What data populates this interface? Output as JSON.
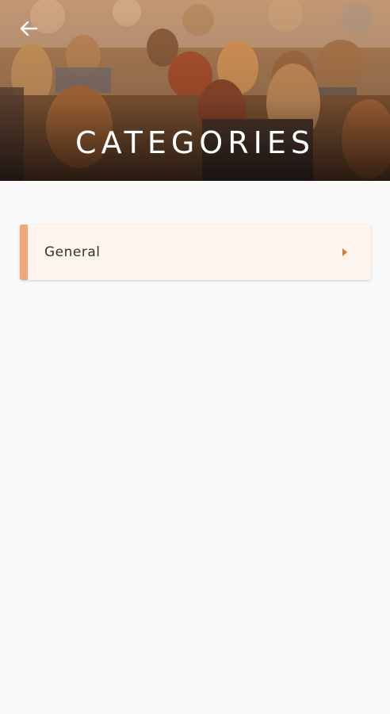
{
  "header": {
    "title": "CATEGORIES",
    "back_icon": "arrow-left-icon"
  },
  "categories": [
    {
      "label": "General",
      "icon": "chevron-right-icon"
    }
  ],
  "colors": {
    "accent": "#f2a77b",
    "chevron": "#e0762d",
    "item_background": "#fdf4ee",
    "page_background": "#f9f9f9"
  }
}
